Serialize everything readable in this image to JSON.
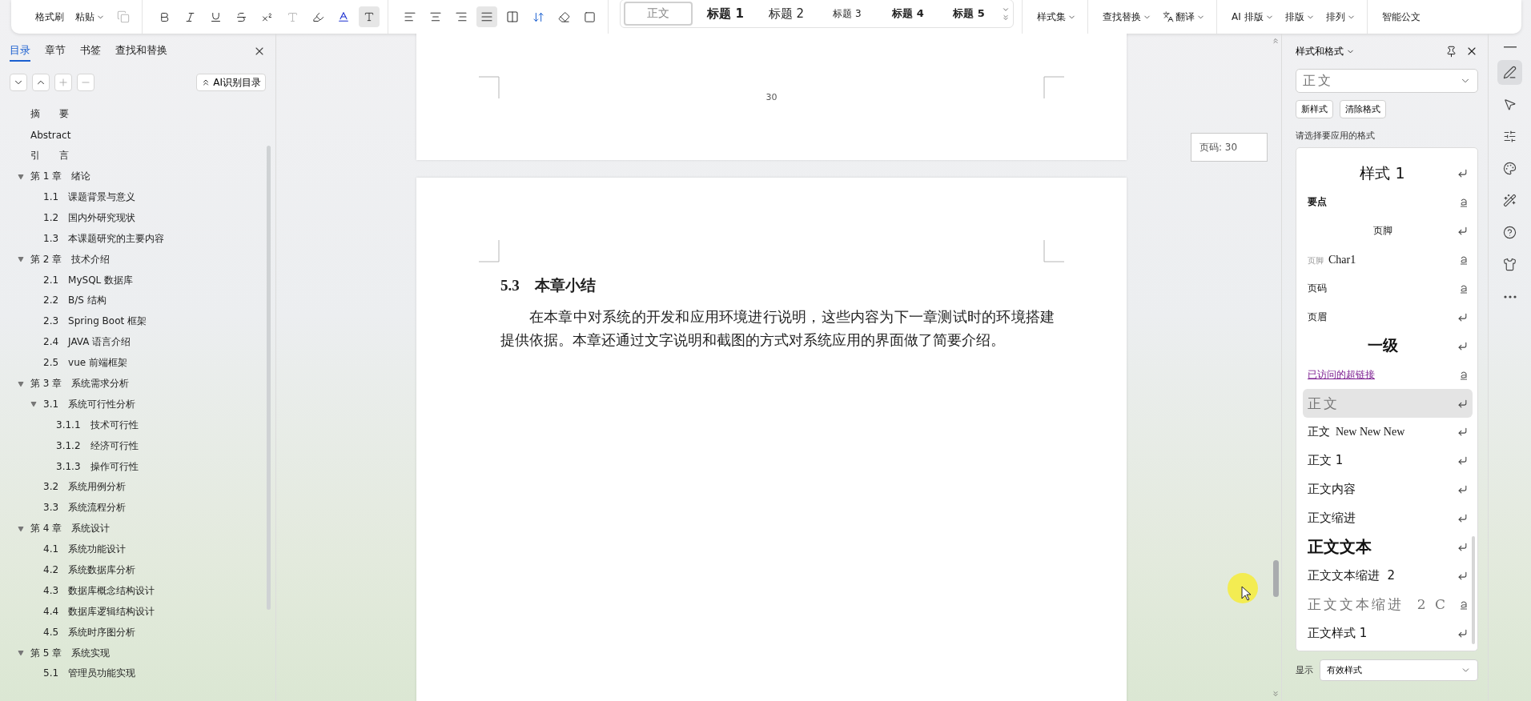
{
  "toolbar": {
    "clipboard": [
      {
        "label": "格式刷",
        "dropdown": false
      },
      {
        "label": "粘贴",
        "dropdown": true
      }
    ],
    "alignment": [
      {
        "kind": "left",
        "selected": false
      },
      {
        "kind": "center",
        "selected": false
      },
      {
        "kind": "right",
        "selected": false
      },
      {
        "kind": "justify",
        "selected": true
      },
      {
        "kind": "distribute",
        "selected": false
      }
    ],
    "gallery": [
      {
        "label": "正文",
        "kind": "body",
        "selected": true
      },
      {
        "label": "标题 1",
        "kind": "h1",
        "selected": false
      },
      {
        "label": "标题 2",
        "kind": "h2",
        "selected": false
      },
      {
        "label": "标题 3",
        "kind": "h3",
        "selected": false
      },
      {
        "label": "标题 4",
        "kind": "h4",
        "selected": false
      },
      {
        "label": "标题 5",
        "kind": "h4",
        "selected": false
      }
    ],
    "command_groups": [
      [
        {
          "label": "样式集",
          "kind": "text",
          "dropdown": true
        }
      ],
      [
        {
          "label": "查找替换",
          "kind": "text",
          "dropdown": true
        },
        {
          "label": "翻译",
          "kind": "translate",
          "dropdown": true
        }
      ],
      [
        {
          "label": "AI 排版",
          "kind": "text",
          "dropdown": true
        },
        {
          "label": "排版",
          "kind": "text",
          "dropdown": true
        },
        {
          "label": "排列",
          "kind": "text",
          "dropdown": true
        }
      ],
      [
        {
          "label": "智能公文",
          "kind": "text",
          "dropdown": false
        }
      ]
    ]
  },
  "nav": {
    "tabs": [
      {
        "label": "目录",
        "selected": true
      },
      {
        "label": "章节",
        "selected": false
      },
      {
        "label": "书签",
        "selected": false
      },
      {
        "label": "查找和替换",
        "selected": false
      }
    ],
    "ai_button": "AI识别目录",
    "outline": [
      {
        "label": "摘　　要"
      },
      {
        "label": "Abstract"
      },
      {
        "label": "引　　言"
      },
      {
        "label": "第 1 章　绪论",
        "expanded": true,
        "children": [
          {
            "label": "1.1　课题背景与意义"
          },
          {
            "label": "1.2　国内外研究现状"
          },
          {
            "label": "1.3　本课题研究的主要内容"
          }
        ]
      },
      {
        "label": "第 2 章　技术介绍",
        "expanded": true,
        "children": [
          {
            "label": "2.1　MySQL 数据库"
          },
          {
            "label": "2.2　B/S 结构"
          },
          {
            "label": "2.3　Spring Boot 框架"
          },
          {
            "label": "2.4　JAVA 语言介绍"
          },
          {
            "label": "2.5　vue 前端框架"
          }
        ]
      },
      {
        "label": "第 3 章　系统需求分析",
        "expanded": true,
        "children": [
          {
            "label": "3.1　系统可行性分析",
            "expanded": true,
            "children": [
              {
                "label": "3.1.1　技术可行性"
              },
              {
                "label": "3.1.2　经济可行性"
              },
              {
                "label": "3.1.3　操作可行性"
              }
            ]
          },
          {
            "label": "3.2　系统用例分析"
          },
          {
            "label": "3.3　系统流程分析"
          }
        ]
      },
      {
        "label": "第 4 章　系统设计",
        "expanded": true,
        "children": [
          {
            "label": "4.1　系统功能设计"
          },
          {
            "label": "4.2　系统数据库分析"
          },
          {
            "label": "4.3　数据库概念结构设计"
          },
          {
            "label": "4.4　数据库逻辑结构设计"
          },
          {
            "label": "4.5　系统时序图分析"
          }
        ]
      },
      {
        "label": "第 5 章　系统实现",
        "expanded": true,
        "children": [
          {
            "label": "5.1　管理员功能实现"
          }
        ]
      }
    ]
  },
  "document": {
    "page_number": "30",
    "heading": "5.3　本章小结",
    "paragraph": "在本章中对系统的开发和应用环境进行说明，这些内容为下一章测试时的环境搭建提供依据。本章还通过文字说明和截图的方式对系统应用的界面做了简要介绍。",
    "page_badge": "页码: 30"
  },
  "styles_panel": {
    "title": "样式和格式",
    "current": "正文",
    "buttons": [
      "新样式",
      "清除格式"
    ],
    "prompt": "请选择要应用的格式",
    "items": [
      {
        "label": "样式 1",
        "kind": "title",
        "paragraph": true,
        "selected": false
      },
      {
        "label": "要点",
        "kind": "bold",
        "paragraph": false,
        "selected": false
      },
      {
        "label": "页脚",
        "kind": "small",
        "paragraph": true,
        "selected": false
      },
      {
        "prefix": "页脚",
        "label": "Char1",
        "kind": "serif",
        "paragraph": false,
        "selected": false
      },
      {
        "label": "页码",
        "kind": "plain",
        "paragraph": false,
        "selected": false
      },
      {
        "label": "页眉",
        "kind": "plain",
        "paragraph": true,
        "selected": false
      },
      {
        "label": "一级",
        "kind": "heading",
        "paragraph": true,
        "selected": false
      },
      {
        "label": "已访问的超链接",
        "kind": "link",
        "paragraph": false,
        "selected": false
      },
      {
        "label": "正文",
        "kind": "spaced",
        "paragraph": true,
        "selected": true
      },
      {
        "label": "正文  New New New",
        "kind": "serif",
        "paragraph": true,
        "selected": false
      },
      {
        "label": "正文 1",
        "kind": "medium",
        "paragraph": true,
        "selected": false
      },
      {
        "label": "正文内容",
        "kind": "medium",
        "paragraph": true,
        "selected": false
      },
      {
        "label": "正文缩进",
        "kind": "medium",
        "paragraph": true,
        "selected": false
      },
      {
        "label": "正文文本",
        "kind": "strong",
        "paragraph": true,
        "selected": false
      },
      {
        "label": "正文文本缩进  2",
        "kind": "medium",
        "paragraph": true,
        "selected": false
      },
      {
        "label": "正文文本缩进  2 C",
        "kind": "spaced",
        "paragraph": false,
        "selected": false
      },
      {
        "label": "正文样式 1",
        "kind": "medium",
        "paragraph": true,
        "selected": false
      }
    ],
    "show_label": "显示",
    "show_value": "有效样式"
  },
  "side_tools": [
    {
      "kind": "pen",
      "selected": true
    },
    {
      "kind": "pointer",
      "selected": false
    },
    {
      "kind": "sliders",
      "selected": false
    },
    {
      "kind": "palette",
      "selected": false
    },
    {
      "kind": "magic",
      "selected": false
    },
    {
      "kind": "help",
      "selected": false
    },
    {
      "kind": "shirt",
      "selected": false
    },
    {
      "kind": "more",
      "selected": false
    }
  ]
}
